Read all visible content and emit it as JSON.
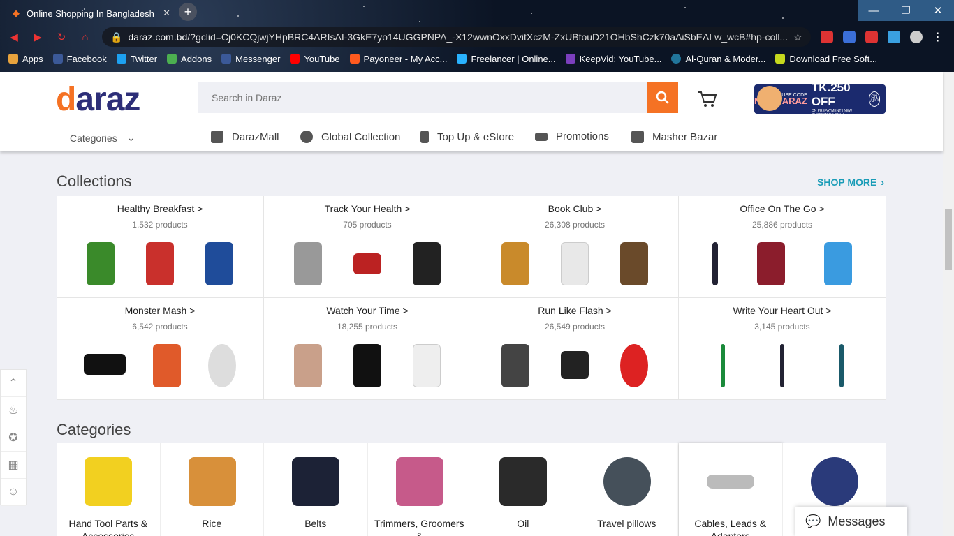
{
  "browser": {
    "tab_title": "Online Shopping In Bangladesh",
    "url_domain": "daraz.com.bd",
    "url_rest": "/?gclid=Cj0KCQjwjYHpBRC4ARIsAI-3GkE7yo14UGGPNPA_-X12wwnOxxDvitXczM-ZxUBfouD21OHbShCzk70aAiSbEALw_wcB#hp-coll...",
    "bookmarks": [
      "Apps",
      "Facebook",
      "Twitter",
      "Addons",
      "Messenger",
      "YouTube",
      "Payoneer - My Acc...",
      "Freelancer | Online...",
      "KeepVid: YouTube...",
      "Al-Quran & Moder...",
      "Download Free Soft..."
    ]
  },
  "header": {
    "logo": "daraz",
    "search_placeholder": "Search in Daraz",
    "promo": {
      "use_code": "USE CODE",
      "code": "NEWDARAZ",
      "offer": "TK.250 OFF",
      "fine": "ON PREPAYMENT | NEW CUSTOMERS ONLY",
      "on_app": "ON APP"
    }
  },
  "nav": {
    "categories": "Categories",
    "links": [
      "DarazMall",
      "Global Collection",
      "Top Up & eStore",
      "Promotions",
      "Masher Bazar"
    ]
  },
  "collections": {
    "title": "Collections",
    "shop_more": "SHOP MORE",
    "items": [
      {
        "name": "Healthy Breakfast >",
        "count": "1,532 products"
      },
      {
        "name": "Track Your Health >",
        "count": "705 products"
      },
      {
        "name": "Book Club >",
        "count": "26,308 products"
      },
      {
        "name": "Office On The Go >",
        "count": "25,886 products"
      },
      {
        "name": "Monster Mash >",
        "count": "6,542 products"
      },
      {
        "name": "Watch Your Time >",
        "count": "18,255 products"
      },
      {
        "name": "Run Like Flash >",
        "count": "26,549 products"
      },
      {
        "name": "Write Your Heart Out >",
        "count": "3,145 products"
      }
    ]
  },
  "categories": {
    "title": "Categories",
    "items": [
      "Hand Tool Parts & Accessories",
      "Rice",
      "Belts",
      "Trimmers, Groomers &",
      "Oil",
      "Travel pillows",
      "Cables, Leads & Adapters",
      ""
    ]
  },
  "messages": "Messages"
}
